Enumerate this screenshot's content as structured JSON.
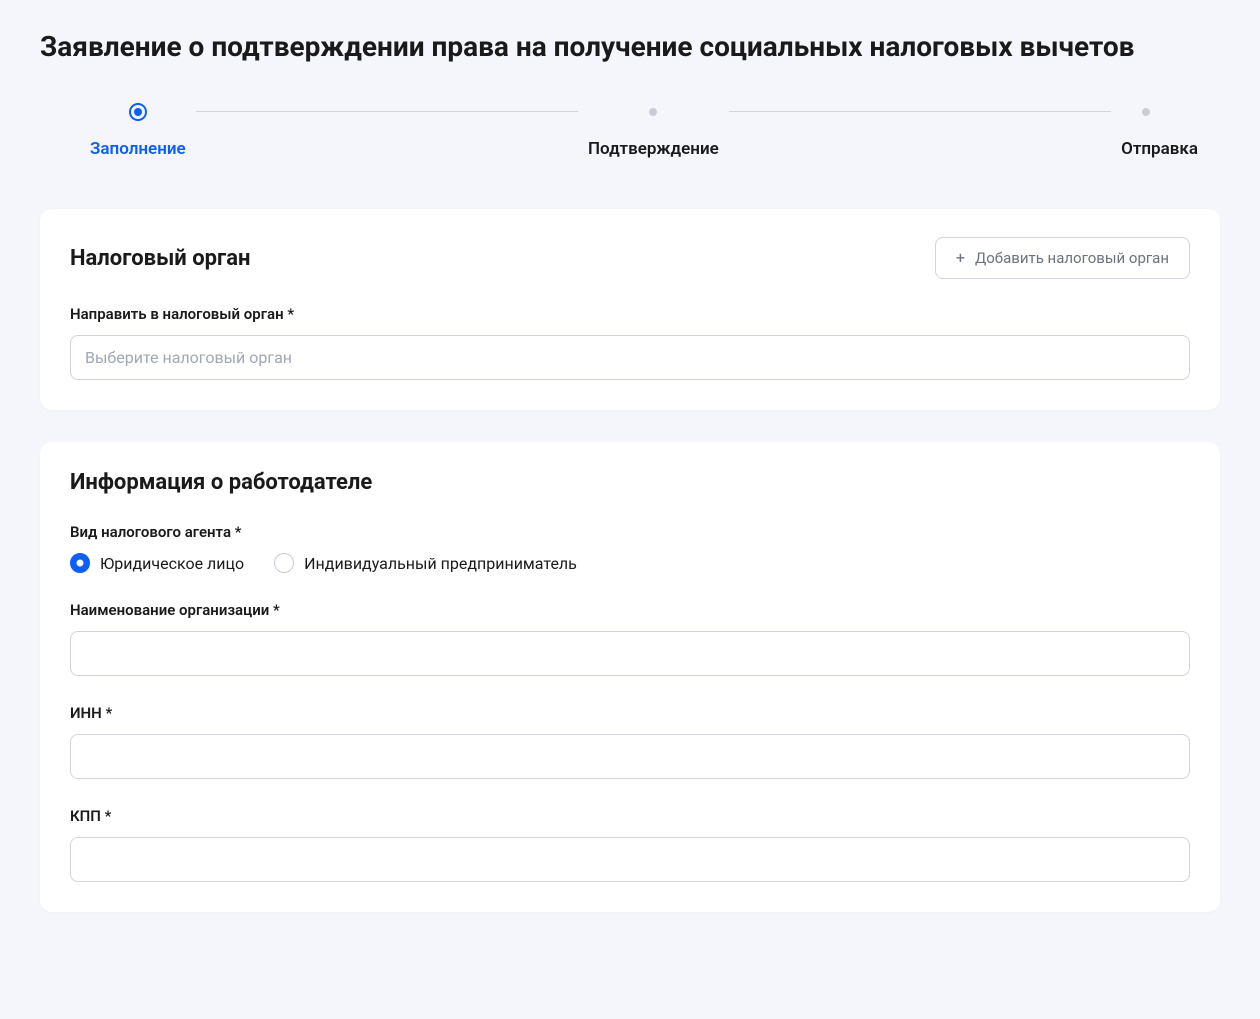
{
  "page_title": "Заявление о подтверждении права на получение социальных налоговых вычетов",
  "stepper": {
    "steps": [
      {
        "label": "Заполнение",
        "active": true
      },
      {
        "label": "Подтверждение",
        "active": false
      },
      {
        "label": "Отправка",
        "active": false
      }
    ]
  },
  "tax_authority_card": {
    "title": "Налоговый орган",
    "add_button_label": "Добавить налоговый орган",
    "field_label": "Направить в налоговый орган *",
    "field_placeholder": "Выберите налоговый орган",
    "field_value": ""
  },
  "employer_card": {
    "title": "Информация о работодателе",
    "agent_type_label": "Вид налогового агента *",
    "agent_type_options": {
      "legal_entity": "Юридическое лицо",
      "individual_entrepreneur": "Индивидуальный предприниматель"
    },
    "agent_type_selected": "legal_entity",
    "org_name_label": "Наименование организации *",
    "org_name_value": "",
    "inn_label": "ИНН *",
    "inn_value": "",
    "kpp_label": "КПП *",
    "kpp_value": ""
  }
}
